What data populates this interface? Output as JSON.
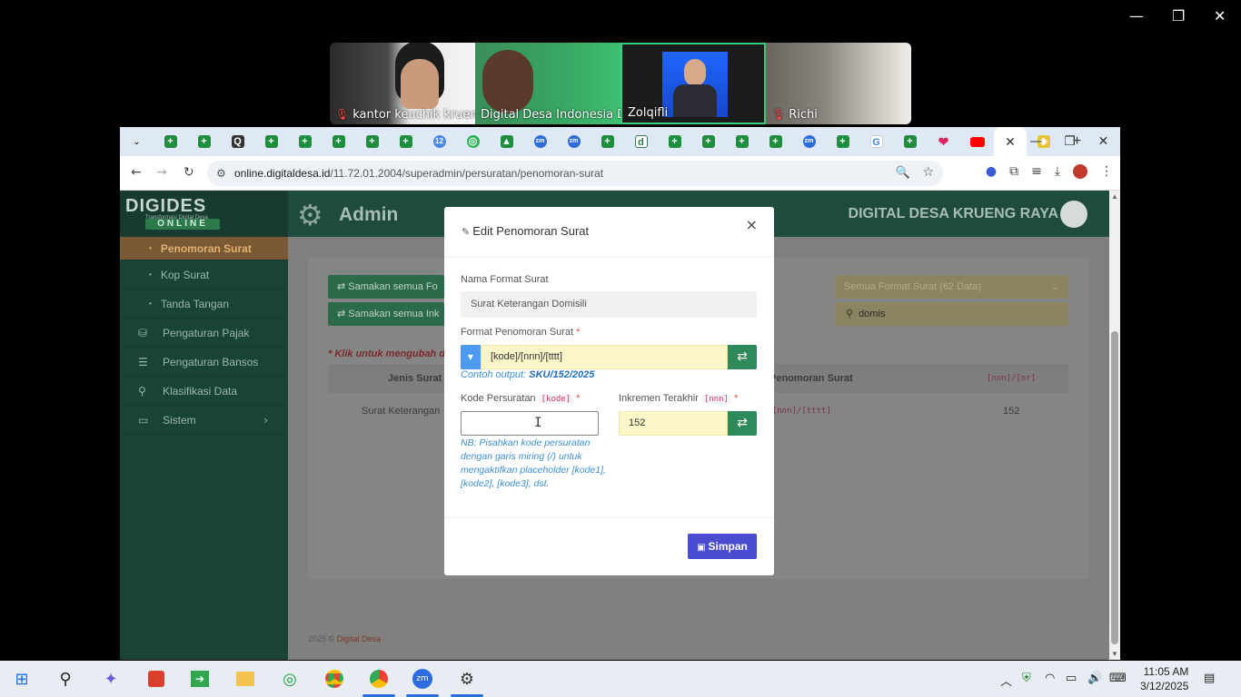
{
  "zoom_window": {
    "minimize": "—",
    "restore": "❐",
    "close": "✕"
  },
  "video_tiles": [
    {
      "name": "kantor keuchik kruen..."
    },
    {
      "name": "Digital Desa Indonesia D..."
    },
    {
      "name": "Zolqifli"
    },
    {
      "name": "Richi"
    }
  ],
  "browser": {
    "new_tab": "+",
    "active_tab_close": "✕",
    "url_host": "online.digitaldesa.id",
    "url_path": "/11.72.01.2004/superadmin/persuratan/penomoran-surat",
    "window": {
      "minimize": "—",
      "restore": "❐",
      "close": "✕"
    }
  },
  "app": {
    "brand": "DIGIDES",
    "brand_tag": "Transformasi Digital Desa",
    "brand_badge": "ONLINE",
    "admin_title": "Admin",
    "village_name": "DIGITAL DESA KRUENG RAYA",
    "sidebar": [
      {
        "label": "Penomoran Surat",
        "kind": "sub",
        "active": true
      },
      {
        "label": "Kop Surat",
        "kind": "sub"
      },
      {
        "label": "Tanda Tangan",
        "kind": "sub"
      },
      {
        "label": "Pengaturan Pajak",
        "kind": "top",
        "icon": "⛁"
      },
      {
        "label": "Pengaturan Bansos",
        "kind": "top",
        "icon": "☰"
      },
      {
        "label": "Klasifikasi Data",
        "kind": "top",
        "icon": "⚲"
      },
      {
        "label": "Sistem",
        "kind": "top",
        "icon": "▭",
        "chevron": "›"
      }
    ],
    "toolbar": {
      "sync_all_format": "⇄ Samakan semua Fo",
      "sync_all_increment": "⇄ Samakan semua Ink",
      "format_filter": "Semua Format Surat (62 Data)",
      "search_value": "domis"
    },
    "table_note": "* Klik untuk mengubah d",
    "table": {
      "col_jenis": "Jenis Surat",
      "col_penomoran": "Penomoran Surat",
      "col_nnn": "[nnn]/[nr]",
      "row_jenis": "Surat Keterangan",
      "row_format": "]/[nnn]/[tttt]",
      "row_nnn": "152"
    },
    "footer": {
      "copy": "2025 ©",
      "brand": "Digital Desa"
    }
  },
  "modal": {
    "title": "Edit Penomoran Surat",
    "close": "×",
    "nama_label": "Nama Format Surat",
    "nama_value": "Surat Keterangan Domisili",
    "format_label": "Format Penomoran Surat",
    "format_value": "[kode]/[nnn]/[tttt]",
    "example_prefix": "Contoh output:",
    "example_value": "SKU/152/2025",
    "kode_label": "Kode Persuratan",
    "kode_tag": "[kode]",
    "kode_value": "",
    "increment_label": "Inkremen Terakhir",
    "increment_tag": "[nnn]",
    "increment_value": "152",
    "note": "NB: Pisahkan kode persuratan dengan garis miring (/) untuk mengaktifkan placeholder [kode1], [kode2], [kode3], dst.",
    "save": "Simpan",
    "required": "*"
  },
  "taskbar": {
    "time": "11:05 AM",
    "date": "3/12/2025"
  }
}
